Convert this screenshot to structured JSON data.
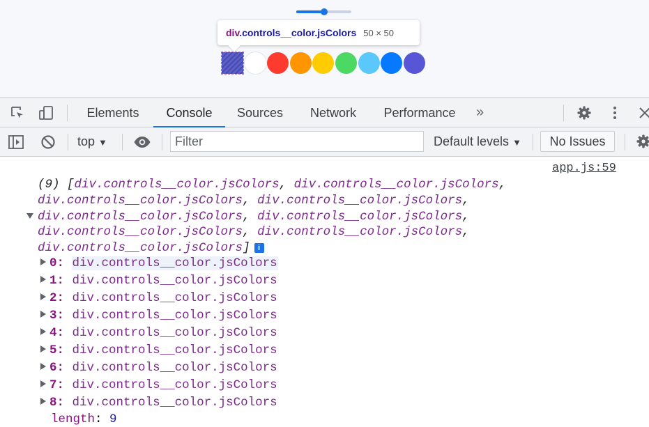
{
  "page": {
    "slider": {
      "value_fraction": 0.5
    },
    "tooltip": {
      "tag": "div",
      "class_name": ".controls__color.jsColors",
      "size": "50 × 50"
    },
    "swatches": [
      {
        "color": "#5b5fcf",
        "selected": true
      },
      {
        "color": "#ffffff"
      },
      {
        "color": "#ff3b30"
      },
      {
        "color": "#ff9500"
      },
      {
        "color": "#ffcc00"
      },
      {
        "color": "#4cd963"
      },
      {
        "color": "#5ac8fa"
      },
      {
        "color": "#0579ff"
      },
      {
        "color": "#5856d6"
      }
    ]
  },
  "devtools": {
    "tabs": [
      {
        "label": "Elements"
      },
      {
        "label": "Console",
        "active": true
      },
      {
        "label": "Sources"
      },
      {
        "label": "Network"
      },
      {
        "label": "Performance"
      }
    ],
    "toolbar": {
      "context": "top",
      "filter_placeholder": "Filter",
      "levels": "Default levels",
      "issues": "No Issues"
    },
    "console": {
      "source_link": "app.js:59",
      "summary_count": "(9)",
      "summary_items": [
        "div.controls__color.jsColors",
        "div.controls__color.jsColors",
        "div.controls__color.jsColors",
        "div.controls__color.jsColors",
        "div.controls__color.jsColors",
        "div.controls__color.jsColors",
        "div.controls__color.jsColors",
        "div.controls__color.jsColors",
        "div.controls__color.jsColors"
      ],
      "items": [
        {
          "index": "0",
          "value": "div.controls__color.jsColors"
        },
        {
          "index": "1",
          "value": "div.controls__color.jsColors"
        },
        {
          "index": "2",
          "value": "div.controls__color.jsColors"
        },
        {
          "index": "3",
          "value": "div.controls__color.jsColors"
        },
        {
          "index": "4",
          "value": "div.controls__color.jsColors"
        },
        {
          "index": "5",
          "value": "div.controls__color.jsColors"
        },
        {
          "index": "6",
          "value": "div.controls__color.jsColors"
        },
        {
          "index": "7",
          "value": "div.controls__color.jsColors"
        },
        {
          "index": "8",
          "value": "div.controls__color.jsColors"
        }
      ],
      "length_key": "length",
      "length_value": "9"
    }
  }
}
